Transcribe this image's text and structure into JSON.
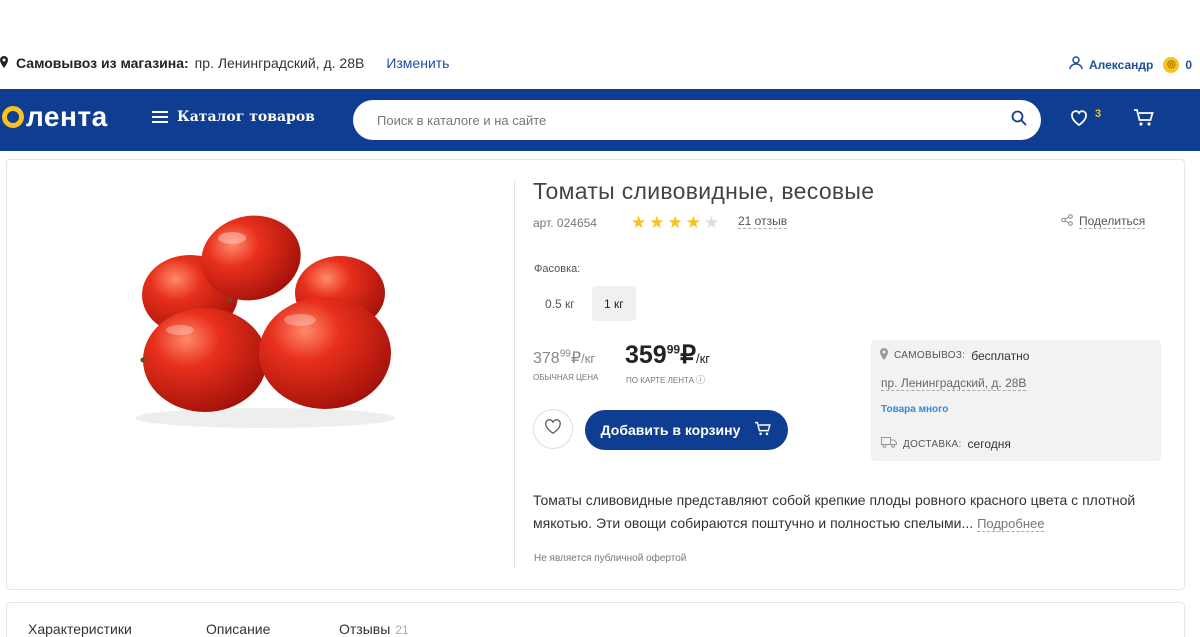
{
  "topbar": {
    "pickup_label": "Самовывоз из магазина:",
    "pickup_address": "пр. Ленинградский, д. 28В",
    "change_label": "Изменить",
    "user_name": "Александр",
    "points": "0"
  },
  "header": {
    "logo_text": "лента",
    "catalog_label": "Каталог товаров",
    "search_placeholder": "Поиск в каталоге и на сайте",
    "favorites_count": "3",
    "brand_blue": "#0f3d91",
    "brand_yellow": "#f7c31c"
  },
  "product": {
    "title": "Томаты сливовидные, весовые",
    "article": "арт. 024654",
    "rating": 4,
    "rating_max": 5,
    "reviews": "21 отзыв",
    "share_label": "Поделиться",
    "packaging_label": "Фасовка:",
    "packaging_options": [
      {
        "label": "0.5 кг",
        "selected": false
      },
      {
        "label": "1 кг",
        "selected": true
      }
    ],
    "regular_price": {
      "whole": "378",
      "fraction": "99",
      "currency": "₽",
      "unit": "/кг",
      "caption": "ОБЫЧНАЯ ЦЕНА"
    },
    "card_price": {
      "whole": "359",
      "fraction": "99",
      "currency": "₽",
      "unit": "/кг",
      "caption": "ПО КАРТЕ ЛЕНТА"
    },
    "add_to_cart_label": "Добавить в корзину",
    "description": "Томаты сливовидные представляют собой крепкие плоды ровного красного цвета с плотной мякотью. Эти овощи собираются поштучно и полностью спелыми...",
    "more_label": "Подробнее",
    "offer_note": "Не является публичной офертой"
  },
  "delivery": {
    "pickup_label": "САМОВЫВОЗ:",
    "pickup_value": "бесплатно",
    "address": "пр. Ленинградский, д. 28В",
    "stock": "Товара много",
    "delivery_label": "ДОСТАВКА:",
    "delivery_value": "сегодня"
  },
  "tabs": [
    {
      "label": "Характеристики",
      "count": ""
    },
    {
      "label": "Описание",
      "count": ""
    },
    {
      "label": "Отзывы",
      "count": "21"
    }
  ]
}
